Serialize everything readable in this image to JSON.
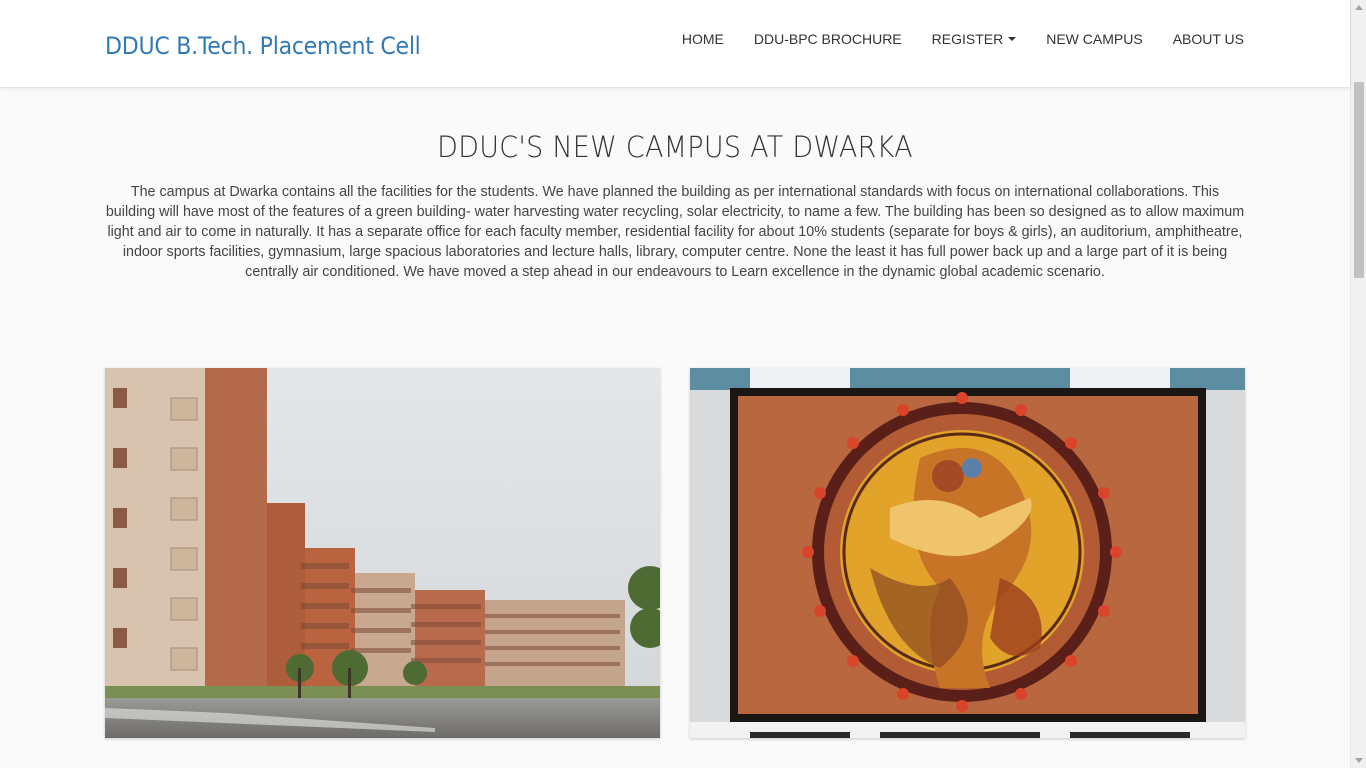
{
  "navbar": {
    "brand": "DDUC B.Tech. Placement Cell",
    "items": [
      {
        "label": "HOME"
      },
      {
        "label": "DDU-BPC BROCHURE"
      },
      {
        "label": "REGISTER"
      },
      {
        "label": "NEW CAMPUS"
      },
      {
        "label": "ABOUT US"
      }
    ]
  },
  "main": {
    "title": "DDUC'S NEW CAMPUS AT DWARKA",
    "description": "The campus at Dwarka contains all the facilities for the students. We have planned the building as per international standards with focus on international collaborations. This building will have most of the features of a green building- water harvesting water recycling, solar electricity, to name a few. The building has been so designed as to allow maximum light and air to come in naturally. It has a separate office for each faculty member, residential facility for about 10% students (separate for boys & girls), an auditorium, amphitheatre, indoor sports facilities, gymnasium, large spacious laboratories and lecture halls, library, computer centre. None the least it has full power back up and a large part of it is being centrally air conditioned. We have moved a step ahead in our endeavours to Learn excellence in the dynamic global academic scenario."
  },
  "colors": {
    "brand": "#337ab7",
    "background": "#fafafa",
    "navbar": "#ffffff"
  },
  "icons": {
    "register_dropdown": "caret-down-icon"
  }
}
